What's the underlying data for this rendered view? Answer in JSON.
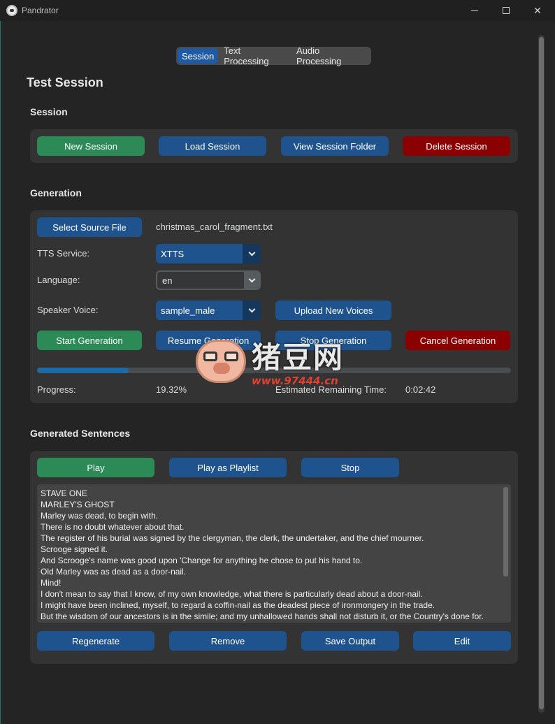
{
  "window": {
    "title": "Pandrator"
  },
  "tabs": [
    {
      "label": "Session",
      "active": true
    },
    {
      "label": "Text Processing",
      "active": false
    },
    {
      "label": "Audio Processing",
      "active": false
    }
  ],
  "page_title": "Test Session",
  "session": {
    "title": "Session",
    "new": "New Session",
    "load": "Load Session",
    "view_folder": "View Session Folder",
    "delete": "Delete Session"
  },
  "generation": {
    "title": "Generation",
    "select_source": "Select Source File",
    "source_file": "christmas_carol_fragment.txt",
    "tts_label": "TTS Service:",
    "tts_value": "XTTS",
    "language_label": "Language:",
    "language_value": "en",
    "speaker_label": "Speaker Voice:",
    "speaker_value": "sample_male",
    "upload_voices": "Upload New Voices",
    "start": "Start Generation",
    "resume": "Resume Generation",
    "stop": "Stop Generation",
    "cancel": "Cancel Generation",
    "progress_label": "Progress:",
    "progress_value": "19.32%",
    "progress_fraction": 0.1932,
    "remaining_label": "Estimated Remaining Time:",
    "remaining_value": "0:02:42"
  },
  "sentences": {
    "title": "Generated Sentences",
    "play": "Play",
    "play_playlist": "Play as Playlist",
    "stop": "Stop",
    "lines": [
      "STAVE ONE",
      "MARLEY'S GHOST",
      "Marley was dead, to begin with.",
      "There is no doubt whatever about that.",
      "The register of his burial was signed by the clergyman, the clerk, the undertaker, and the chief mourner.",
      "Scrooge signed it.",
      "And Scrooge's name was good upon 'Change for anything he chose to put his hand to.",
      "Old Marley was as dead as a door-nail.",
      "Mind!",
      "I don't mean to say that I know, of my own knowledge, what there is particularly dead about a door-nail.",
      "I might have been inclined, myself, to regard a coffin-nail as the deadest piece of ironmongery in the trade.",
      "But the wisdom of our ancestors is in the simile; and my unhallowed hands shall not disturb it, or the Country's done for."
    ],
    "regenerate": "Regenerate",
    "remove": "Remove",
    "save_output": "Save Output",
    "edit": "Edit"
  },
  "watermark": {
    "text": "猪豆网",
    "url": "www.97444.cn"
  },
  "colors": {
    "accent_blue": "#1f538d",
    "green": "#2c8a57",
    "red": "#8b0000",
    "panel": "#333333",
    "background": "#242424"
  }
}
